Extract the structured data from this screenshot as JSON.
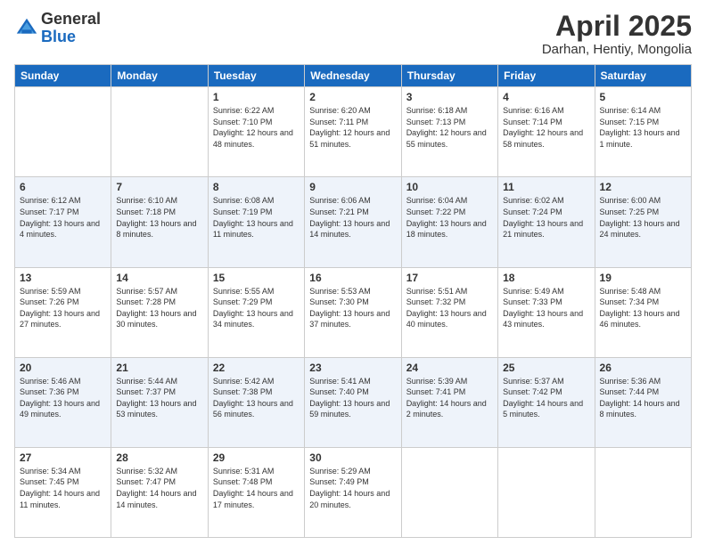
{
  "header": {
    "logo": {
      "general": "General",
      "blue": "Blue"
    },
    "title": "April 2025",
    "location": "Darhan, Hentiy, Mongolia"
  },
  "weekdays": [
    "Sunday",
    "Monday",
    "Tuesday",
    "Wednesday",
    "Thursday",
    "Friday",
    "Saturday"
  ],
  "weeks": [
    [
      {
        "day": "",
        "info": ""
      },
      {
        "day": "",
        "info": ""
      },
      {
        "day": "1",
        "info": "Sunrise: 6:22 AM\nSunset: 7:10 PM\nDaylight: 12 hours and 48 minutes."
      },
      {
        "day": "2",
        "info": "Sunrise: 6:20 AM\nSunset: 7:11 PM\nDaylight: 12 hours and 51 minutes."
      },
      {
        "day": "3",
        "info": "Sunrise: 6:18 AM\nSunset: 7:13 PM\nDaylight: 12 hours and 55 minutes."
      },
      {
        "day": "4",
        "info": "Sunrise: 6:16 AM\nSunset: 7:14 PM\nDaylight: 12 hours and 58 minutes."
      },
      {
        "day": "5",
        "info": "Sunrise: 6:14 AM\nSunset: 7:15 PM\nDaylight: 13 hours and 1 minute."
      }
    ],
    [
      {
        "day": "6",
        "info": "Sunrise: 6:12 AM\nSunset: 7:17 PM\nDaylight: 13 hours and 4 minutes."
      },
      {
        "day": "7",
        "info": "Sunrise: 6:10 AM\nSunset: 7:18 PM\nDaylight: 13 hours and 8 minutes."
      },
      {
        "day": "8",
        "info": "Sunrise: 6:08 AM\nSunset: 7:19 PM\nDaylight: 13 hours and 11 minutes."
      },
      {
        "day": "9",
        "info": "Sunrise: 6:06 AM\nSunset: 7:21 PM\nDaylight: 13 hours and 14 minutes."
      },
      {
        "day": "10",
        "info": "Sunrise: 6:04 AM\nSunset: 7:22 PM\nDaylight: 13 hours and 18 minutes."
      },
      {
        "day": "11",
        "info": "Sunrise: 6:02 AM\nSunset: 7:24 PM\nDaylight: 13 hours and 21 minutes."
      },
      {
        "day": "12",
        "info": "Sunrise: 6:00 AM\nSunset: 7:25 PM\nDaylight: 13 hours and 24 minutes."
      }
    ],
    [
      {
        "day": "13",
        "info": "Sunrise: 5:59 AM\nSunset: 7:26 PM\nDaylight: 13 hours and 27 minutes."
      },
      {
        "day": "14",
        "info": "Sunrise: 5:57 AM\nSunset: 7:28 PM\nDaylight: 13 hours and 30 minutes."
      },
      {
        "day": "15",
        "info": "Sunrise: 5:55 AM\nSunset: 7:29 PM\nDaylight: 13 hours and 34 minutes."
      },
      {
        "day": "16",
        "info": "Sunrise: 5:53 AM\nSunset: 7:30 PM\nDaylight: 13 hours and 37 minutes."
      },
      {
        "day": "17",
        "info": "Sunrise: 5:51 AM\nSunset: 7:32 PM\nDaylight: 13 hours and 40 minutes."
      },
      {
        "day": "18",
        "info": "Sunrise: 5:49 AM\nSunset: 7:33 PM\nDaylight: 13 hours and 43 minutes."
      },
      {
        "day": "19",
        "info": "Sunrise: 5:48 AM\nSunset: 7:34 PM\nDaylight: 13 hours and 46 minutes."
      }
    ],
    [
      {
        "day": "20",
        "info": "Sunrise: 5:46 AM\nSunset: 7:36 PM\nDaylight: 13 hours and 49 minutes."
      },
      {
        "day": "21",
        "info": "Sunrise: 5:44 AM\nSunset: 7:37 PM\nDaylight: 13 hours and 53 minutes."
      },
      {
        "day": "22",
        "info": "Sunrise: 5:42 AM\nSunset: 7:38 PM\nDaylight: 13 hours and 56 minutes."
      },
      {
        "day": "23",
        "info": "Sunrise: 5:41 AM\nSunset: 7:40 PM\nDaylight: 13 hours and 59 minutes."
      },
      {
        "day": "24",
        "info": "Sunrise: 5:39 AM\nSunset: 7:41 PM\nDaylight: 14 hours and 2 minutes."
      },
      {
        "day": "25",
        "info": "Sunrise: 5:37 AM\nSunset: 7:42 PM\nDaylight: 14 hours and 5 minutes."
      },
      {
        "day": "26",
        "info": "Sunrise: 5:36 AM\nSunset: 7:44 PM\nDaylight: 14 hours and 8 minutes."
      }
    ],
    [
      {
        "day": "27",
        "info": "Sunrise: 5:34 AM\nSunset: 7:45 PM\nDaylight: 14 hours and 11 minutes."
      },
      {
        "day": "28",
        "info": "Sunrise: 5:32 AM\nSunset: 7:47 PM\nDaylight: 14 hours and 14 minutes."
      },
      {
        "day": "29",
        "info": "Sunrise: 5:31 AM\nSunset: 7:48 PM\nDaylight: 14 hours and 17 minutes."
      },
      {
        "day": "30",
        "info": "Sunrise: 5:29 AM\nSunset: 7:49 PM\nDaylight: 14 hours and 20 minutes."
      },
      {
        "day": "",
        "info": ""
      },
      {
        "day": "",
        "info": ""
      },
      {
        "day": "",
        "info": ""
      }
    ]
  ]
}
